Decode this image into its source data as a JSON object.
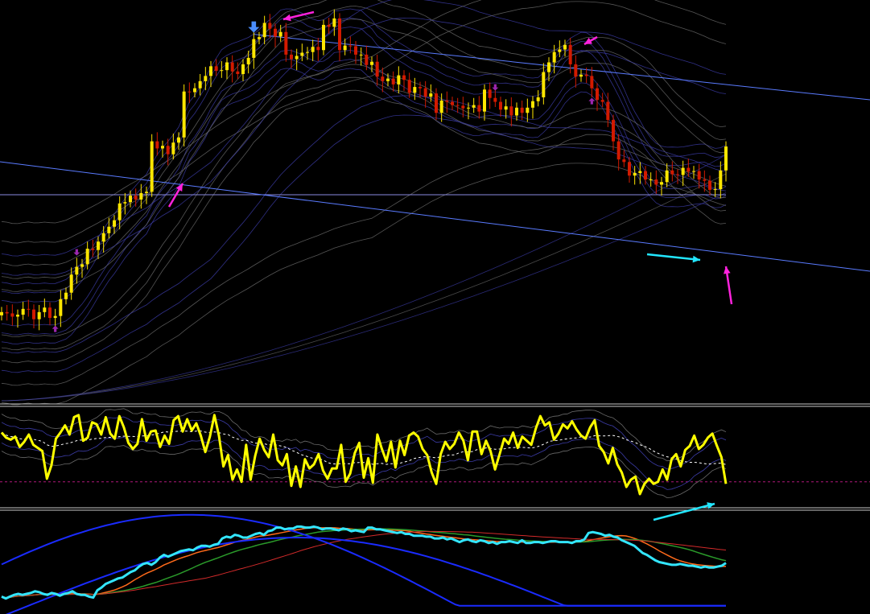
{
  "colors": {
    "background": "#000000",
    "bull_candle": "#ffe600",
    "bear_candle": "#d21a00",
    "trendline": "#5a7bff",
    "horizontal_line": "#8a8adf",
    "band_gray": "#6a6a6a",
    "band_blue": "#3c3ca8",
    "fractal_marker": "#9c27b0",
    "signal_arrow_blue": "#4a8dff",
    "annotation_magenta": "#ff22dd",
    "annotation_cyan": "#22e6ff",
    "oscillator_line": "#ffff00",
    "oscillator_signal": "#ffffff",
    "oscillator_level": "#b0187a",
    "lower_price_line": "#33e6ff",
    "lower_blue": "#1a2bff",
    "lower_orange": "#ff6a1a",
    "lower_green": "#2a9a2a",
    "lower_red": "#d22a2a",
    "separator": "#c8c8c8"
  },
  "chart_data": [
    {
      "panel": "price",
      "type": "candlestick",
      "series": [
        {
          "values": [
            0.4,
            0.38,
            0.33,
            0.36,
            0.45,
            0.44,
            0.29,
            0.4,
            0.47,
            0.31,
            0.34,
            0.6,
            0.7,
            0.98,
            1.1,
            1.14,
            1.38,
            1.36,
            1.49,
            1.62,
            1.72,
            1.82,
            2.08,
            2.1,
            2.2,
            2.14,
            2.24,
            2.26,
            3.04,
            2.93,
            2.97,
            2.84,
            3.02,
            3.1,
            3.81,
            3.8,
            3.86,
            3.97,
            4.05,
            4.2,
            4.13,
            4.14,
            4.26,
            4.12,
            4.08,
            4.23,
            4.33,
            4.62,
            4.65,
            4.87,
            4.78,
            4.66,
            4.73,
            4.38,
            4.31,
            4.36,
            4.41,
            4.42,
            4.5,
            4.45,
            4.84,
            4.81,
            4.94,
            4.45,
            4.52,
            4.51,
            4.38,
            4.38,
            4.22,
            4.27,
            4.04,
            3.97,
            4.01,
            3.92,
            4.06,
            3.99,
            3.79,
            3.88,
            3.86,
            3.73,
            3.78,
            3.48,
            3.67,
            3.65,
            3.6,
            3.59,
            3.55,
            3.56,
            3.6,
            3.5,
            3.84,
            3.71,
            3.65,
            3.53,
            3.58,
            3.44,
            3.56,
            3.48,
            3.56,
            3.66,
            3.72,
            4.11,
            4.26,
            4.42,
            4.46,
            4.53,
            4.23,
            4.04,
            4.07,
            4.05,
            3.86,
            3.68,
            3.65,
            3.37,
            3.04,
            2.76,
            2.72,
            2.51,
            2.55,
            2.58,
            2.45,
            2.45,
            2.37,
            2.41,
            2.59,
            2.53,
            2.52,
            2.63,
            2.57,
            2.58,
            2.45,
            2.43,
            2.29,
            2.3,
            2.59,
            2.96
          ]
        }
      ],
      "annotations": [
        {
          "type": "down-arrow",
          "color": "blue",
          "at_index": 47
        },
        {
          "type": "up-arrow",
          "color": "blue",
          "at_index": 137
        },
        {
          "type": "fractal-down",
          "at_index": 10
        },
        {
          "type": "fractal-up",
          "at_index": 14
        },
        {
          "type": "fractal-down",
          "at_index": 110
        },
        {
          "type": "fractal-up",
          "at_index": 92
        }
      ]
    },
    {
      "panel": "oscillator",
      "type": "line",
      "series": [
        {
          "values": [
            60,
            55,
            53,
            56,
            46,
            51,
            58,
            48,
            45,
            42,
            15,
            28,
            54,
            60,
            67,
            58,
            75,
            77,
            52,
            55,
            70,
            68,
            58,
            75,
            59,
            54,
            76,
            65,
            50,
            44,
            49,
            73,
            52,
            61,
            62,
            46,
            57,
            49,
            72,
            76,
            61,
            73,
            62,
            69,
            57,
            41,
            56,
            77,
            57,
            27,
            38,
            14,
            24,
            12,
            48,
            14,
            37,
            54,
            43,
            36,
            58,
            33,
            28,
            39,
            8,
            27,
            7,
            34,
            25,
            29,
            39,
            23,
            15,
            25,
            25,
            48,
            12,
            20,
            40,
            50,
            16,
            35,
            11,
            58,
            44,
            32,
            51,
            26,
            52,
            38,
            57,
            60,
            56,
            44,
            38,
            21,
            10,
            39,
            51,
            44,
            49,
            60,
            52,
            33,
            61,
            61,
            39,
            52,
            42,
            24,
            39,
            54,
            49,
            60,
            45,
            56,
            52,
            48,
            64,
            76,
            67,
            70,
            53,
            59,
            68,
            64,
            71,
            63,
            57,
            54,
            65,
            72,
            47,
            41,
            30,
            45,
            29,
            21,
            7,
            14,
            17,
            0,
            10,
            15,
            10,
            12,
            24,
            14,
            34,
            39,
            27,
            43,
            47,
            57,
            44,
            48,
            55,
            59,
            47,
            36,
            10
          ]
        }
      ]
    },
    {
      "panel": "lower",
      "type": "line",
      "series": [
        {
          "values": [
            0.12,
            0.1,
            0.12,
            0.14,
            0.15,
            0.14,
            0.15,
            0.16,
            0.18,
            0.17,
            0.15,
            0.14,
            0.16,
            0.15,
            0.13,
            0.15,
            0.16,
            0.18,
            0.15,
            0.14,
            0.14,
            0.12,
            0.11,
            0.19,
            0.22,
            0.26,
            0.28,
            0.3,
            0.32,
            0.33,
            0.36,
            0.39,
            0.41,
            0.45,
            0.48,
            0.49,
            0.47,
            0.5,
            0.55,
            0.58,
            0.56,
            0.58,
            0.6,
            0.62,
            0.63,
            0.64,
            0.63,
            0.66,
            0.68,
            0.68,
            0.67,
            0.69,
            0.7,
            0.76,
            0.78,
            0.77,
            0.8,
            0.79,
            0.77,
            0.77,
            0.79,
            0.81,
            0.82,
            0.8,
            0.84,
            0.85,
            0.88,
            0.88,
            0.86,
            0.87,
            0.87,
            0.89,
            0.89,
            0.88,
            0.88,
            0.89,
            0.88,
            0.86,
            0.87,
            0.87,
            0.86,
            0.85,
            0.87,
            0.86,
            0.84,
            0.85,
            0.84,
            0.83,
            0.88,
            0.88,
            0.86,
            0.86,
            0.85,
            0.84,
            0.83,
            0.82,
            0.83,
            0.81,
            0.81,
            0.79,
            0.79,
            0.79,
            0.78,
            0.78,
            0.76,
            0.76,
            0.77,
            0.75,
            0.76,
            0.74,
            0.72,
            0.74,
            0.75,
            0.73,
            0.72,
            0.74,
            0.73,
            0.71,
            0.72,
            0.7,
            0.72,
            0.72,
            0.73,
            0.72,
            0.71,
            0.74,
            0.71,
            0.71,
            0.72,
            0.72,
            0.71,
            0.72,
            0.73,
            0.73,
            0.72,
            0.72,
            0.72,
            0.71,
            0.73,
            0.73,
            0.75,
            0.82,
            0.83,
            0.82,
            0.81,
            0.79,
            0.8,
            0.78,
            0.77,
            0.74,
            0.72,
            0.7,
            0.68,
            0.64,
            0.6,
            0.58,
            0.55,
            0.52,
            0.5,
            0.49,
            0.48,
            0.47,
            0.47,
            0.48,
            0.47,
            0.46,
            0.46,
            0.45,
            0.44,
            0.45,
            0.44,
            0.44,
            0.45,
            0.46,
            0.49
          ]
        }
      ]
    }
  ]
}
